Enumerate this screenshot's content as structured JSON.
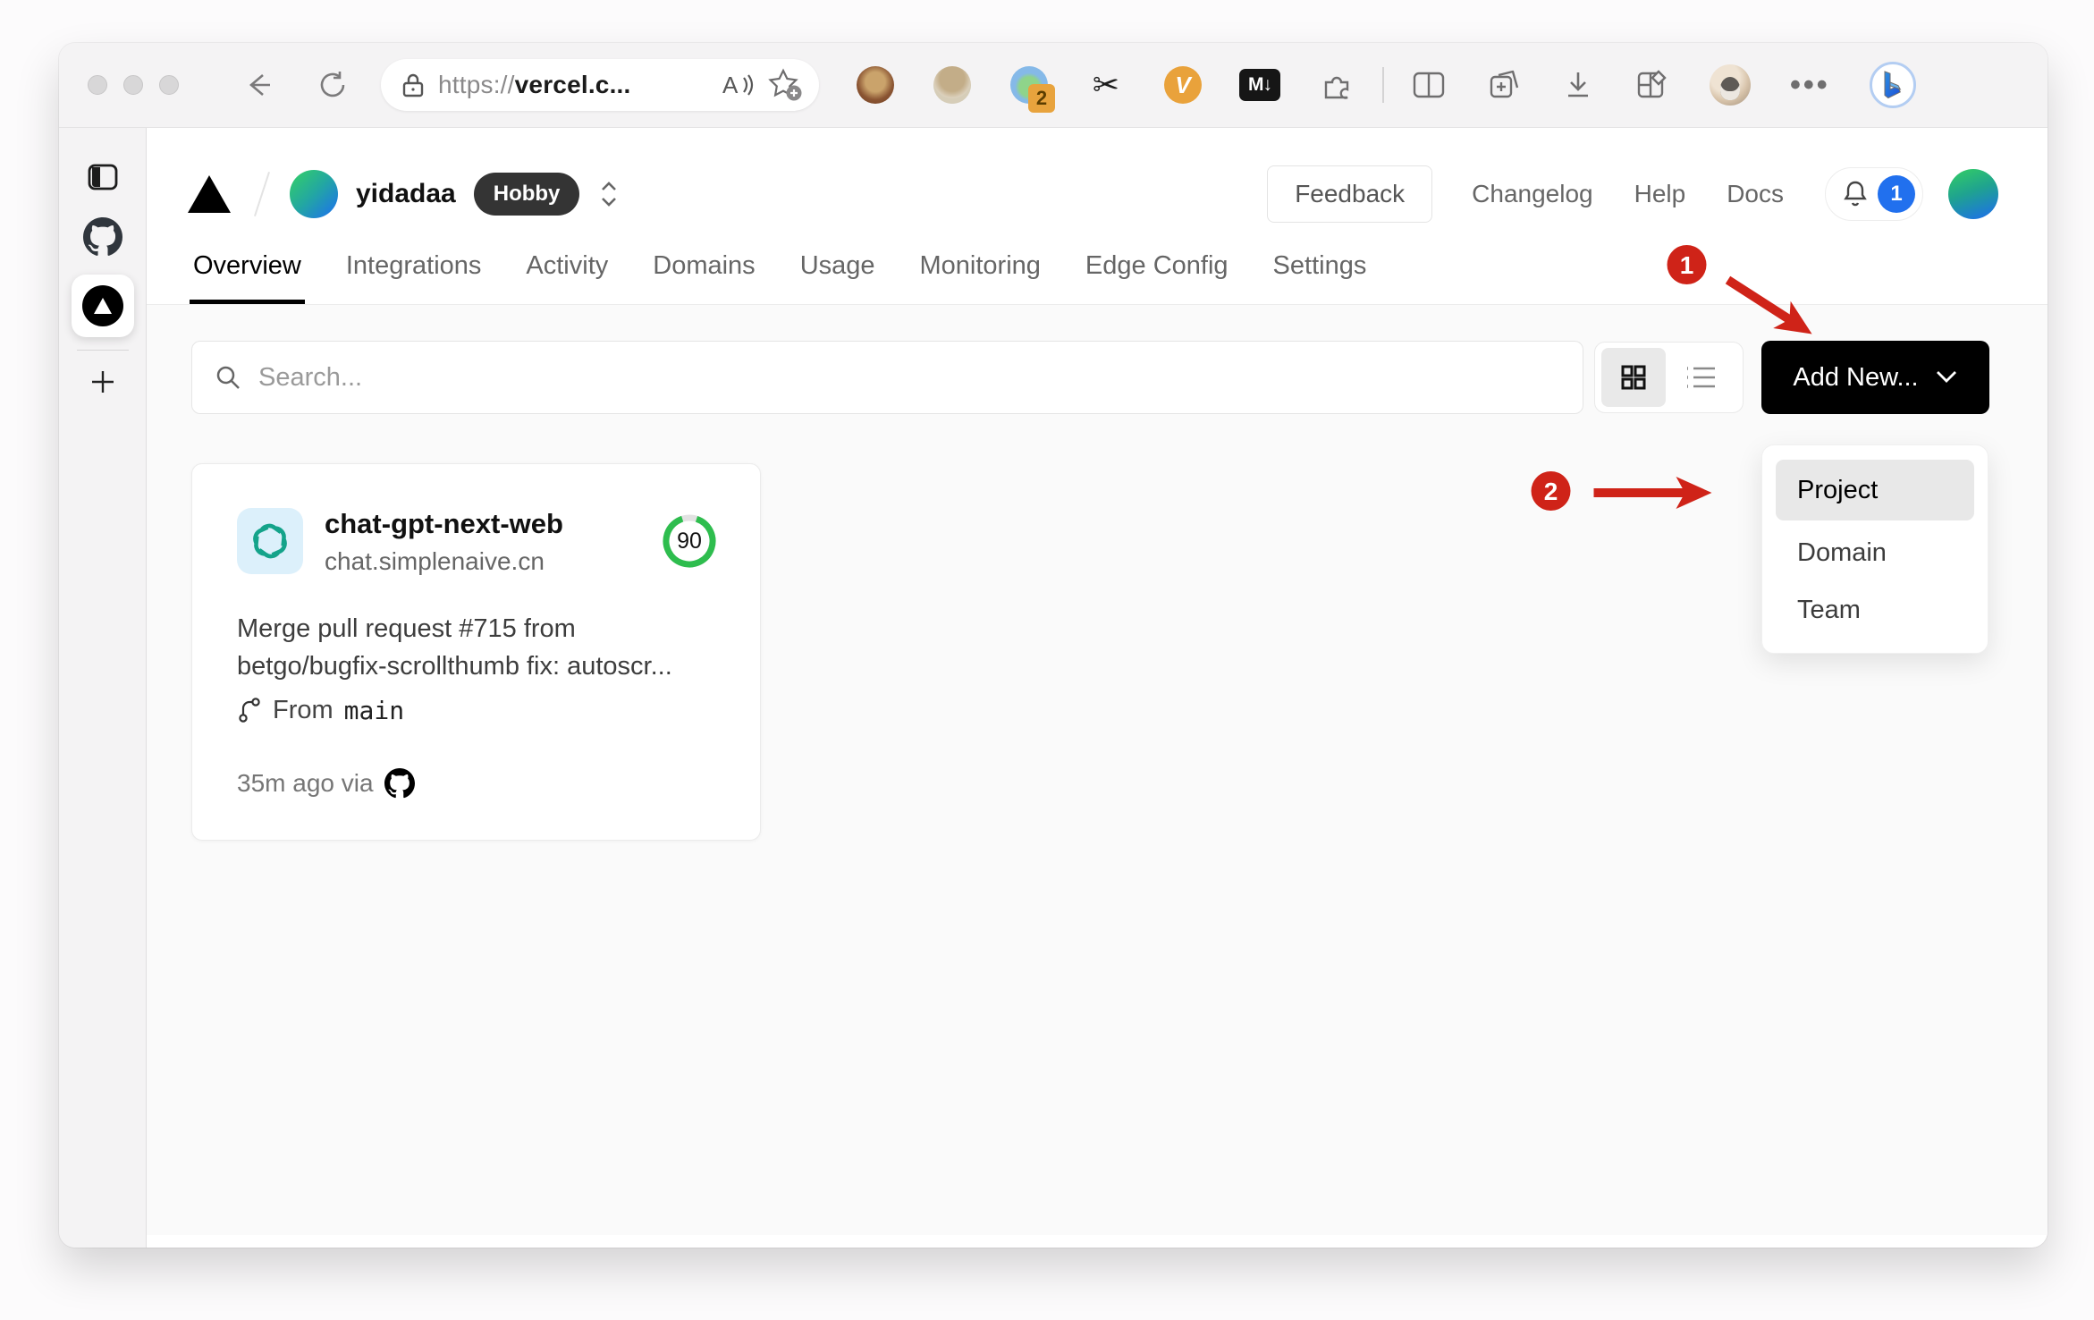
{
  "browser": {
    "url_scheme": "https://",
    "url_host": "vercel.c...",
    "extension_badge_count": "2",
    "scissors_glyph": "✂",
    "v_extension_label": "V",
    "markdown_badge_label": "M↓",
    "ellipsis_glyph": "•••"
  },
  "vercel": {
    "team_name": "yidadaa",
    "plan_badge": "Hobby",
    "feedback_label": "Feedback",
    "nav_links": [
      {
        "label": "Changelog"
      },
      {
        "label": "Help"
      },
      {
        "label": "Docs"
      }
    ],
    "notification_count": "1",
    "tabs": [
      {
        "label": "Overview"
      },
      {
        "label": "Integrations"
      },
      {
        "label": "Activity"
      },
      {
        "label": "Domains"
      },
      {
        "label": "Usage"
      },
      {
        "label": "Monitoring"
      },
      {
        "label": "Edge Config"
      },
      {
        "label": "Settings"
      }
    ],
    "search_placeholder": "Search...",
    "add_new_label": "Add New...",
    "dropdown": {
      "items": [
        {
          "label": "Project"
        },
        {
          "label": "Domain"
        },
        {
          "label": "Team"
        }
      ]
    },
    "project": {
      "name": "chat-gpt-next-web",
      "domain": "chat.simplenaive.cn",
      "score": "90",
      "commit_line1": "Merge pull request #715 from",
      "commit_line2": "betgo/bugfix-scrollthumb fix: autoscr...",
      "branch_prefix": "From",
      "branch_name": "main",
      "deploy_meta": "35m ago via"
    }
  },
  "annotations": {
    "step1": "1",
    "step2": "2"
  },
  "colors": {
    "annotation_red": "#cf2318",
    "notification_blue": "#2170ee",
    "score_green": "#2ebd4e",
    "add_new_black": "#000000"
  }
}
